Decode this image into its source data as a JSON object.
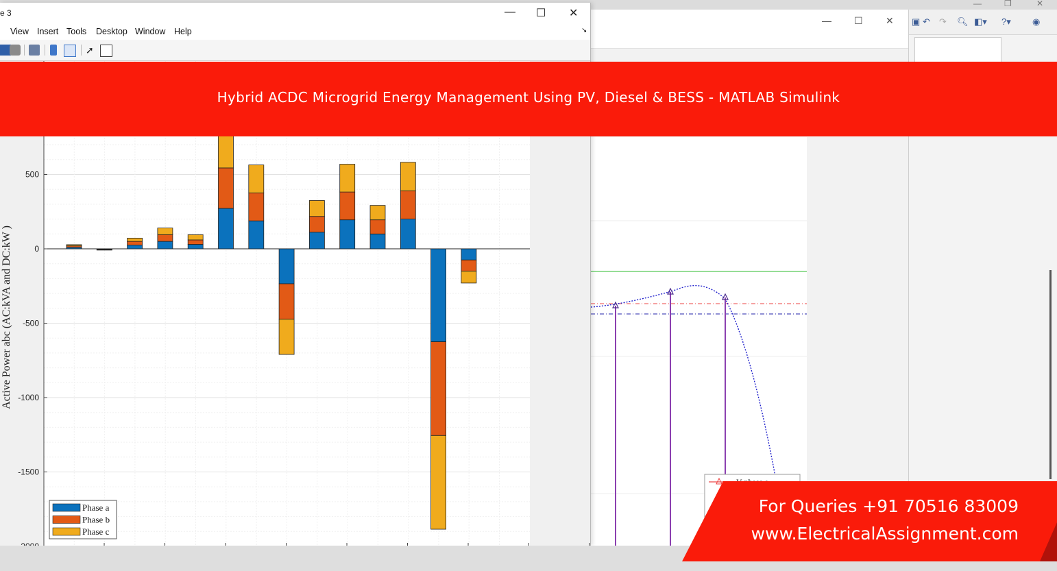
{
  "figure_window": {
    "title_fragment": "e 3",
    "menu": [
      "View",
      "Insert",
      "Tools",
      "Desktop",
      "Window",
      "Help"
    ],
    "window_controls": {
      "minimize": "—",
      "maximize": "☐",
      "close": "✕"
    }
  },
  "banner": {
    "title": "Hybrid ACDC Microgrid Energy Management Using PV, Diesel & BESS - MATLAB Simulink",
    "color": "#fa1b0a"
  },
  "promo": {
    "line1": "For Queries +91 70516 83009",
    "line2": "www.ElectricalAssignment.com"
  },
  "scope": {
    "legend_fragment": "V phase a"
  },
  "chart_data": {
    "type": "bar",
    "stacked": true,
    "ylabel": "Active Power abc (AC:kVA and DC:kW )",
    "yticks": [
      500,
      0,
      -500,
      -1000,
      -1500,
      -2000
    ],
    "ytick_labels": [
      "500",
      "0",
      "-500",
      "-1000",
      "-1500",
      "-2000"
    ],
    "grid": true,
    "legend_position": "bottom-left",
    "series": [
      {
        "name": "Phase a",
        "color": "#0b72bd",
        "values": [
          10,
          -5,
          25,
          50,
          30,
          272,
          188,
          -235,
          112,
          195,
          100,
          200,
          -625,
          -75
        ]
      },
      {
        "name": "Phase b",
        "color": "#e25a16",
        "values": [
          10,
          -3,
          25,
          45,
          30,
          272,
          188,
          -238,
          106,
          187,
          95,
          190,
          -630,
          -75
        ]
      },
      {
        "name": "Phase c",
        "color": "#f0ab1d",
        "values": [
          8,
          0,
          22,
          45,
          35,
          280,
          188,
          -237,
          107,
          187,
          97,
          192,
          -630,
          -80
        ]
      }
    ]
  }
}
